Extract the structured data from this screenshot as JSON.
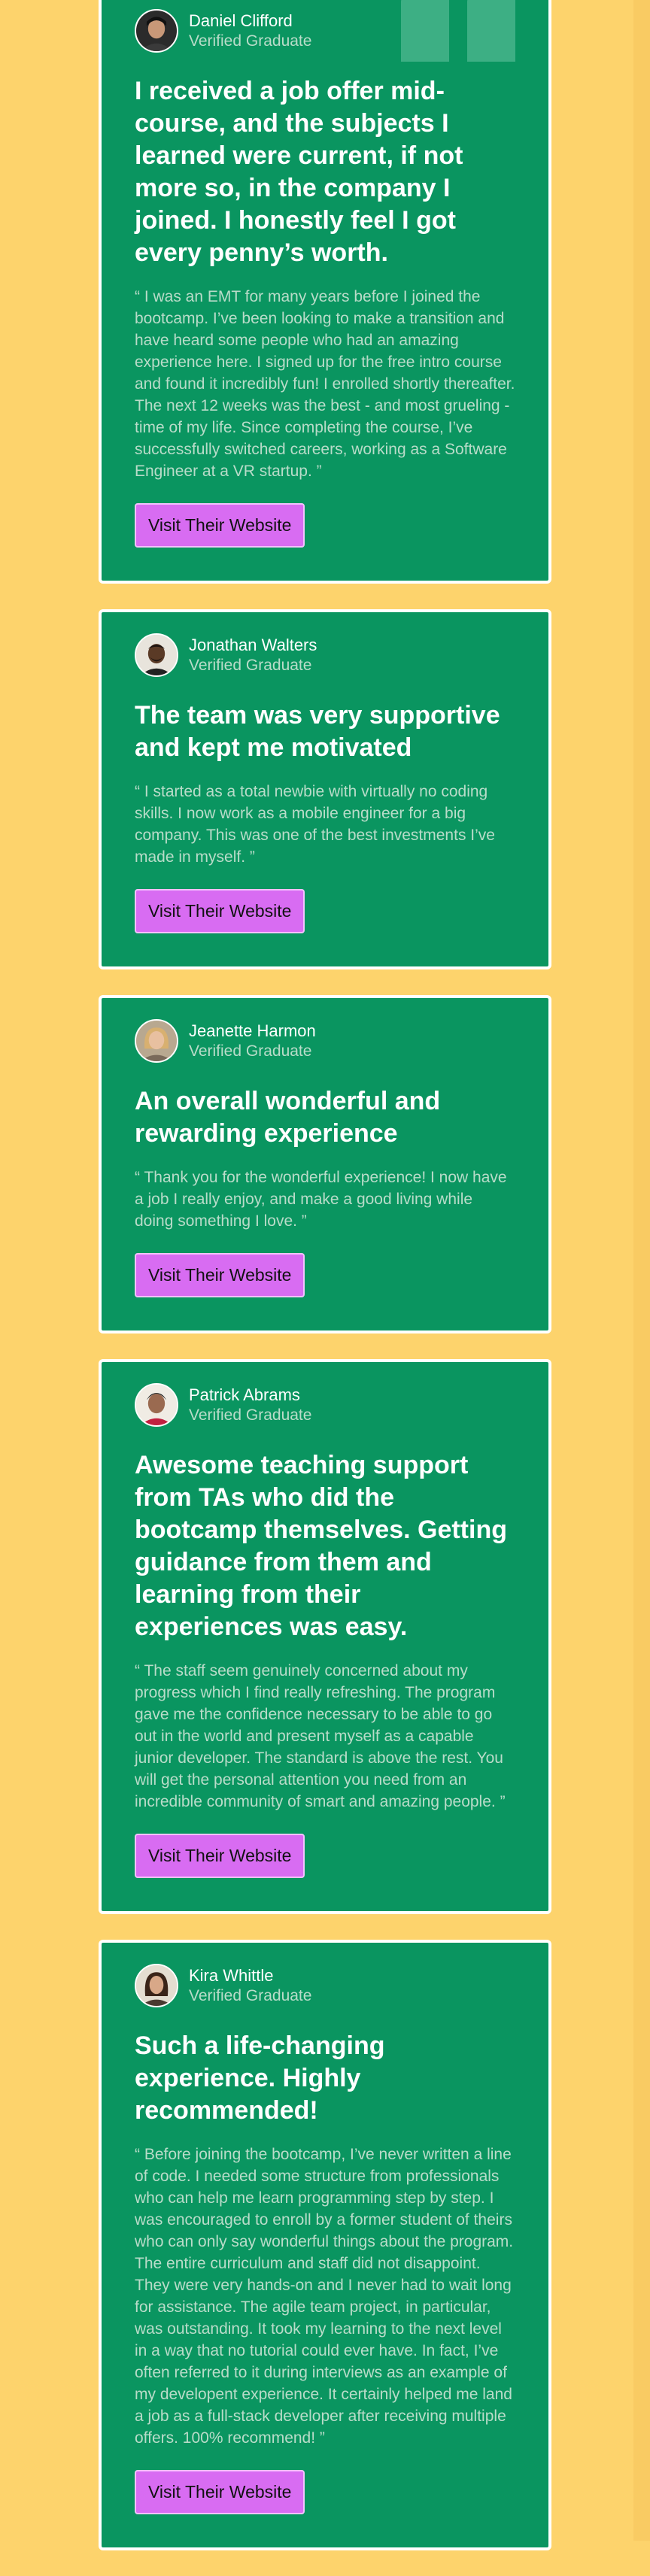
{
  "accent": {
    "card_green": "#0a9560",
    "page_yellow": "#fdd36c",
    "button_purple": "#d86cf2"
  },
  "testimonials": [
    {
      "name": "Daniel Clifford",
      "role": "Verified Graduate",
      "headline": "I received a job offer mid-course, and the subjects I learned were current, if not more so, in the company I joined. I honestly feel I got every penny’s worth.",
      "quote": "“ I was an EMT for many years before I joined the bootcamp. I’ve been looking to make a transition and have heard some people who had an amazing experience here. I signed up for the free intro course and found it incredibly fun! I enrolled shortly thereafter. The next 12 weeks was the best - and most grueling - time of my life. Since completing the course, I’ve successfully switched careers, working as a Software Engineer at a VR startup. ”",
      "button": "Visit Their Website",
      "avatar_icon": "avatar-photo-icon"
    },
    {
      "name": "Jonathan Walters",
      "role": "Verified Graduate",
      "headline": "The team was very supportive and kept me motivated",
      "quote": "“ I started as a total newbie with virtually no coding skills. I now work as a mobile engineer for a big company. This was one of the best investments I’ve made in myself. ”",
      "button": "Visit Their Website",
      "avatar_icon": "avatar-photo-icon"
    },
    {
      "name": "Jeanette Harmon",
      "role": "Verified Graduate",
      "headline": "An overall wonderful and rewarding experience",
      "quote": "“ Thank you for the wonderful experience! I now have a job I really enjoy, and make a good living while doing something I love. ”",
      "button": "Visit Their Website",
      "avatar_icon": "avatar-photo-icon"
    },
    {
      "name": "Patrick Abrams",
      "role": "Verified Graduate",
      "headline": "Awesome teaching support from TAs who did the bootcamp themselves. Getting guidance from them and learning from their experiences was easy.",
      "quote": "“ The staff seem genuinely concerned about my progress which I find really refreshing. The program gave me the confidence necessary to be able to go out in the world and present myself as a capable junior developer. The standard is above the rest. You will get the personal attention you need from an incredible community of smart and amazing people. ”",
      "button": "Visit Their Website",
      "avatar_icon": "avatar-photo-icon"
    },
    {
      "name": "Kira Whittle",
      "role": "Verified Graduate",
      "headline": "Such a life-changing experience. Highly recommended!",
      "quote": "“ Before joining the bootcamp, I’ve never written a line of code. I needed some structure from professionals who can help me learn programming step by step. I was encouraged to enroll by a former student of theirs who can only say wonderful things about the program. The entire curriculum and staff did not disappoint. They were very hands-on and I never had to wait long for assistance. The agile team project, in particular, was outstanding. It took my learning to the next level in a way that no tutorial could ever have. In fact, I’ve often referred to it during interviews as an example of my developent experience. It certainly helped me land a job as a full-stack developer after receiving multiple offers. 100% recommend! ”",
      "button": "Visit Their Website",
      "avatar_icon": "avatar-photo-icon"
    }
  ]
}
